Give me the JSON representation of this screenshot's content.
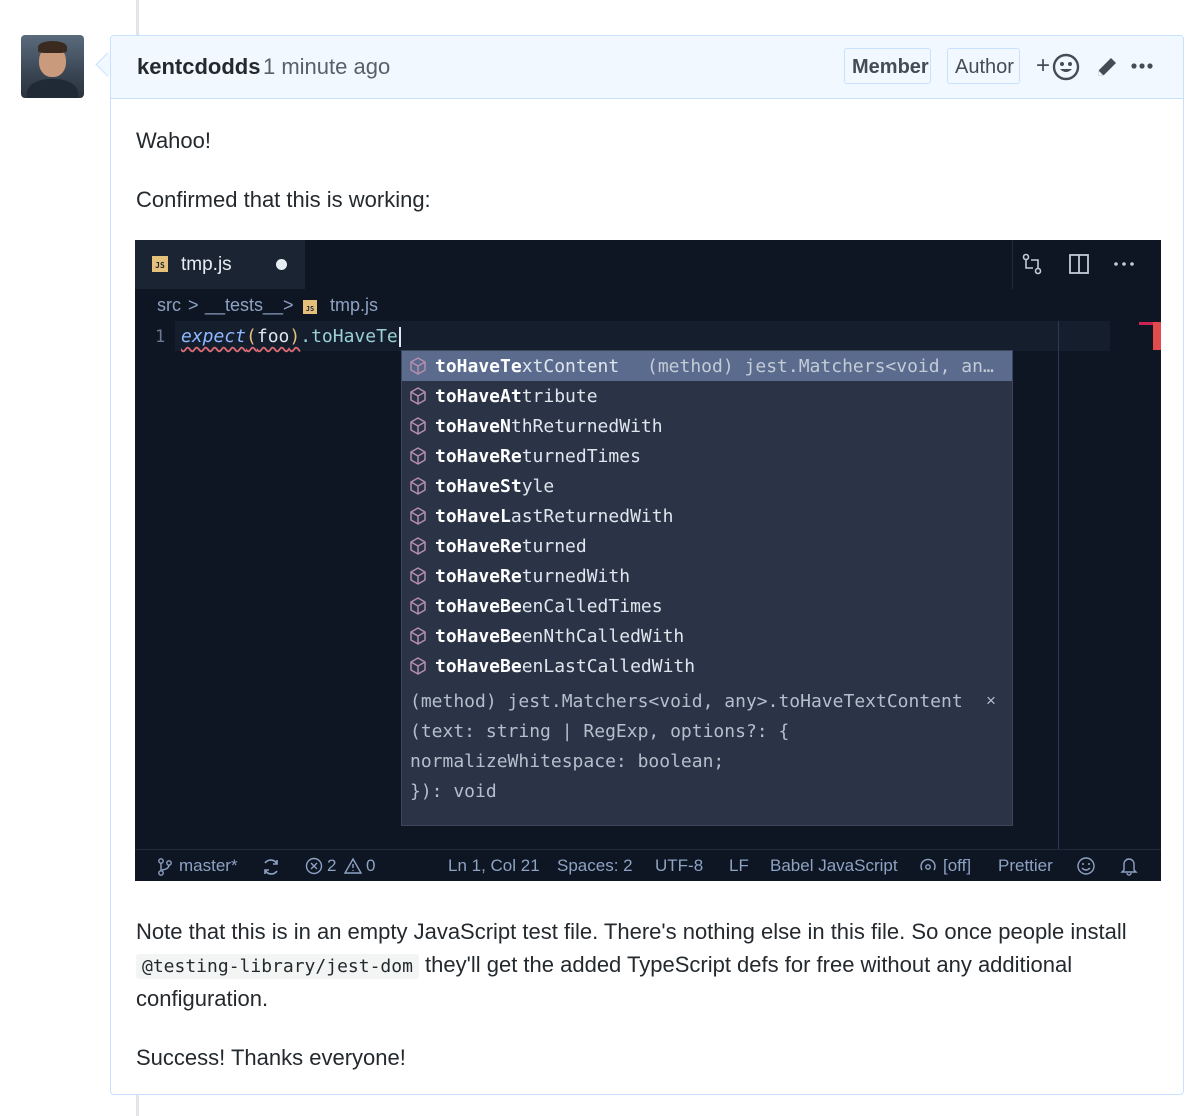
{
  "comment": {
    "author": "kentcdodds",
    "time": "1 minute ago",
    "badges": {
      "member": "Member",
      "author": "Author"
    },
    "add_reaction": "+",
    "paragraphs": {
      "p1": "Wahoo!",
      "p2": "Confirmed that this is working:",
      "p3_line1": "Note that this is in an empty JavaScript test file. There's nothing else in this file. So once people install",
      "p3_code": "@testing-library/jest-dom",
      "p3_line2_rest": " they'll get the added TypeScript defs for free without any additional",
      "p3_line3": "configuration.",
      "p4": "Success! Thanks everyone!"
    }
  },
  "editor": {
    "tab": {
      "icon_text": "JS",
      "filename": "tmp.js"
    },
    "breadcrumb": {
      "src": "src",
      "sep": ">",
      "tests": "__tests__",
      "file": "tmp.js",
      "icon_text": "JS"
    },
    "line_number": "1",
    "code": {
      "keyword": "expect",
      "open": "(",
      "arg": "foo",
      "close": ")",
      "rest": ".toHaveTe"
    },
    "suggestions": [
      {
        "prefix": "toHaveTe",
        "suffix": "xtContent",
        "detail": "(method) jest.Matchers<void, an…",
        "selected": true
      },
      {
        "prefix": "toHaveAt",
        "suffix": "tribute"
      },
      {
        "prefix": "toHaveN",
        "suffix": "thReturnedWith"
      },
      {
        "prefix": "toHaveRe",
        "suffix": "turnedTimes"
      },
      {
        "prefix": "toHaveSt",
        "suffix": "yle"
      },
      {
        "prefix": "toHaveL",
        "suffix": "astReturnedWith"
      },
      {
        "prefix": "toHaveRe",
        "suffix": "turned"
      },
      {
        "prefix": "toHaveRe",
        "suffix": "turnedWith"
      },
      {
        "prefix": "toHaveBe",
        "suffix": "enCalledTimes"
      },
      {
        "prefix": "toHaveBe",
        "suffix": "enNthCalledWith"
      },
      {
        "prefix": "toHaveBe",
        "suffix": "enLastCalledWith"
      }
    ],
    "doc": {
      "line1": "(method) jest.Matchers<void, any>.toHaveTextContent",
      "line2": "(text: string | RegExp, options?: {",
      "line3": "normalizeWhitespace: boolean;",
      "line4": "}): void",
      "close": "×"
    },
    "status": {
      "branch": "master*",
      "errors": "2",
      "warnings": "0",
      "position": "Ln 1, Col 21",
      "spaces": "Spaces: 2",
      "encoding": "UTF-8",
      "eol": "LF",
      "language": "Babel JavaScript",
      "toggle": "[off]",
      "formatter": "Prettier"
    }
  }
}
